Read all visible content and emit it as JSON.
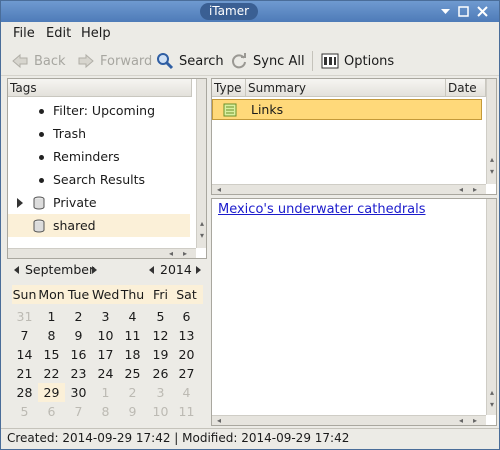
{
  "window": {
    "title": "iTamer"
  },
  "menu": {
    "file": "File",
    "edit": "Edit",
    "help": "Help"
  },
  "toolbar": {
    "back": "Back",
    "forward": "Forward",
    "search": "Search",
    "sync": "Sync All",
    "options": "Options"
  },
  "tags": {
    "header": "Tags",
    "items": [
      {
        "label": "Filter: Upcoming"
      },
      {
        "label": "Trash"
      },
      {
        "label": "Reminders"
      },
      {
        "label": "Search Results"
      },
      {
        "label": "Private"
      },
      {
        "label": "shared"
      }
    ]
  },
  "calendar": {
    "month": "September",
    "year": "2014",
    "weekdays": [
      "Sun",
      "Mon",
      "Tue",
      "Wed",
      "Thu",
      "Fri",
      "Sat"
    ],
    "weeks": [
      [
        "31",
        "1",
        "2",
        "3",
        "4",
        "5",
        "6"
      ],
      [
        "7",
        "8",
        "9",
        "10",
        "11",
        "12",
        "13"
      ],
      [
        "14",
        "15",
        "16",
        "17",
        "18",
        "19",
        "20"
      ],
      [
        "21",
        "22",
        "23",
        "24",
        "25",
        "26",
        "27"
      ],
      [
        "28",
        "29",
        "30",
        "1",
        "2",
        "3",
        "4"
      ],
      [
        "5",
        "6",
        "7",
        "8",
        "9",
        "10",
        "11"
      ]
    ]
  },
  "notes": {
    "columns": {
      "type": "Type",
      "summary": "Summary",
      "date": "Date"
    },
    "rows": [
      {
        "summary": "Links"
      }
    ]
  },
  "content": {
    "link_text": "Mexico's underwater cathedrals"
  },
  "status": {
    "text": "Created: 2014-09-29 17:42  |  Modified: 2014-09-29 17:42"
  },
  "colors": {
    "accent": "#4e7bb8",
    "selection": "#fbf0d8",
    "row_highlight": "#ffd97a"
  }
}
